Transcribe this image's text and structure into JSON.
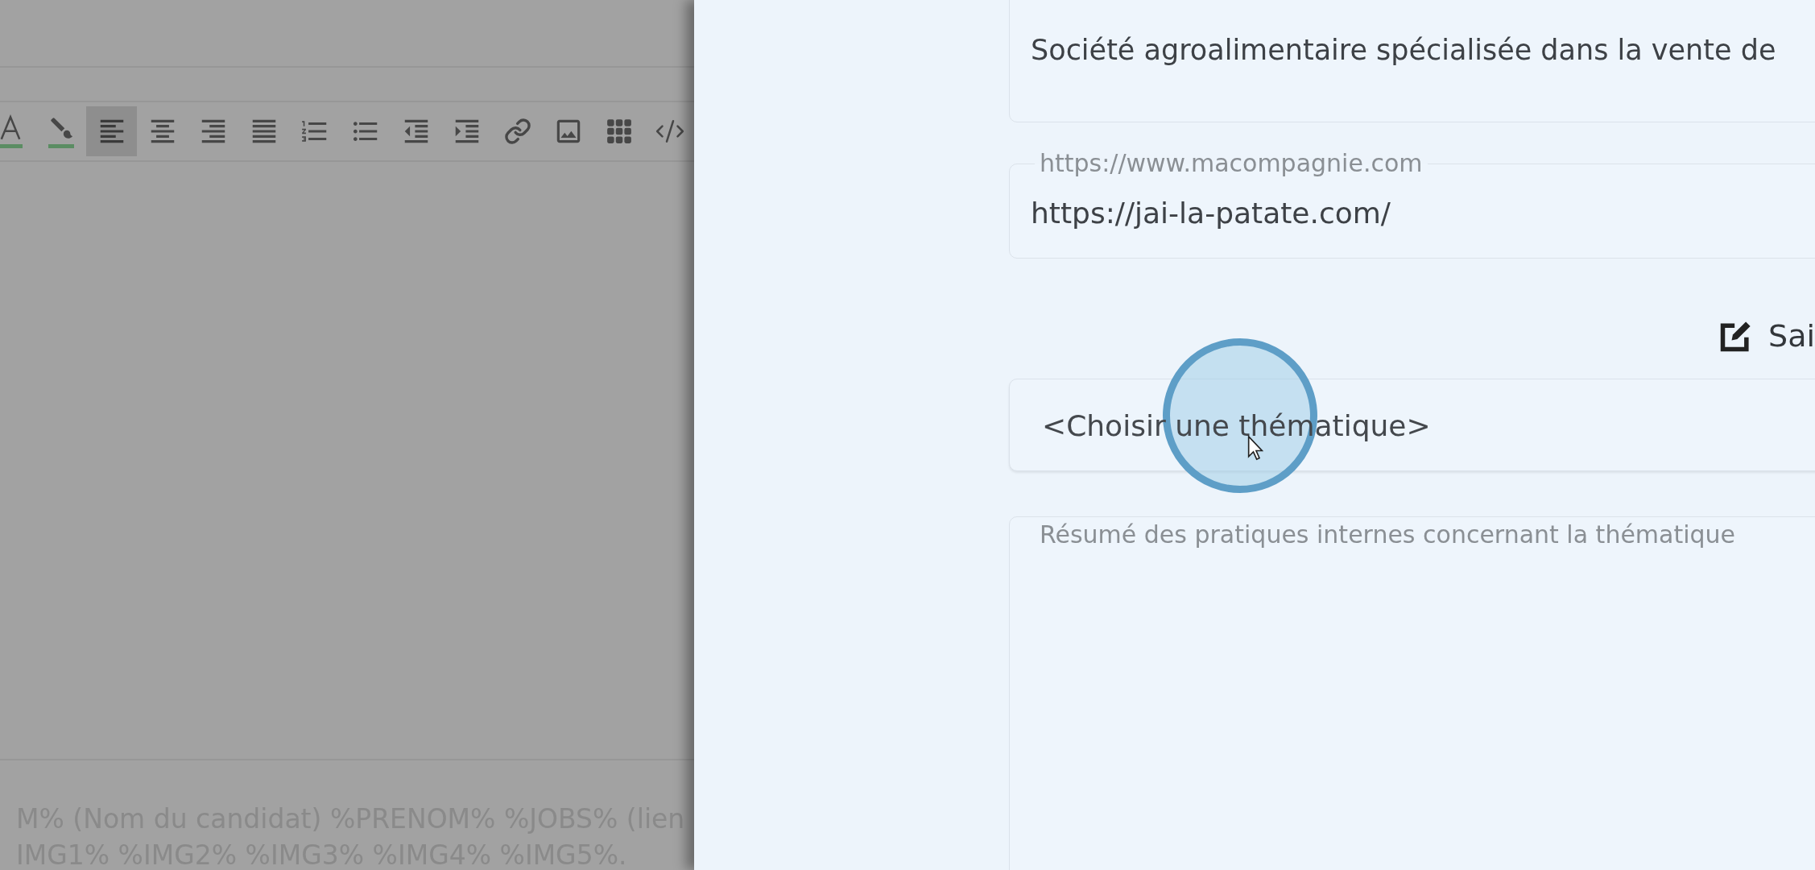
{
  "editor": {
    "toolbar": [
      {
        "kind": "text_color",
        "selected": false
      },
      {
        "kind": "highlight",
        "selected": false
      },
      {
        "kind": "align_left",
        "selected": true
      },
      {
        "kind": "align_center",
        "selected": false
      },
      {
        "kind": "align_right",
        "selected": false
      },
      {
        "kind": "justify",
        "selected": false
      },
      {
        "kind": "numbered_list",
        "selected": false
      },
      {
        "kind": "bullet_list",
        "selected": false
      },
      {
        "kind": "outdent",
        "selected": false
      },
      {
        "kind": "indent",
        "selected": false
      },
      {
        "kind": "link",
        "selected": false
      },
      {
        "kind": "image",
        "selected": false
      },
      {
        "kind": "table",
        "selected": false
      },
      {
        "kind": "code",
        "selected": false
      }
    ],
    "help_text": [
      "M% (Nom du candidat) %PRENOM% %JOBS% (lien",
      "IMG1% %IMG2% %IMG3% %IMG4% %IMG5%."
    ]
  },
  "drawer": {
    "description": {
      "value": "Société agroalimentaire spécialisée dans la vente de"
    },
    "website": {
      "label": "https://www.macompagnie.com",
      "value": "https://jai-la-patate.com/"
    },
    "edit_button": {
      "label": "Sai"
    },
    "theme_select": {
      "value": "<Choisir une thématique>"
    },
    "summary": {
      "label": "Résumé des pratiques internes concernant la thématique"
    }
  }
}
